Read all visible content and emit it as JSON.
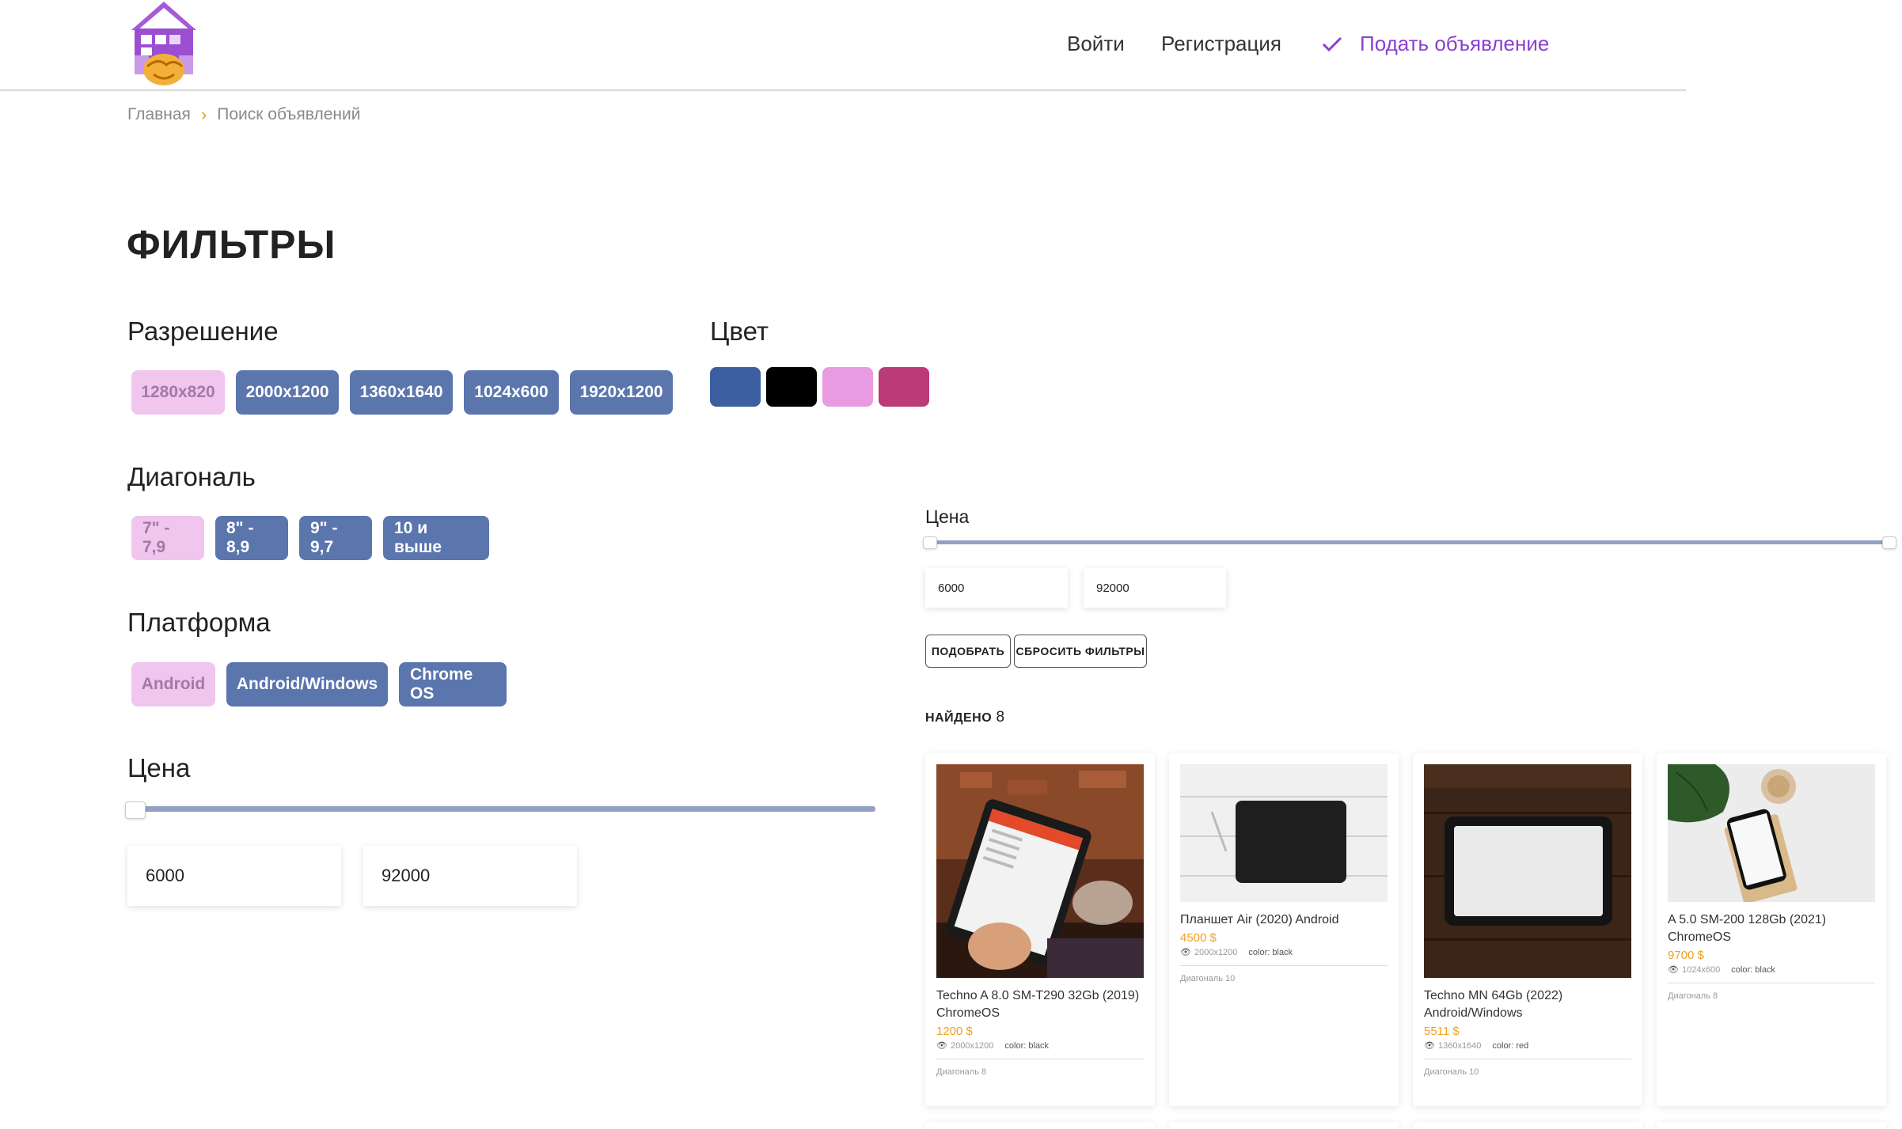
{
  "header": {
    "login": "Войти",
    "register": "Регистрация",
    "post_ad": "Подать объявление"
  },
  "breadcrumb": {
    "home": "Главная",
    "current": "Поиск объявлений"
  },
  "filters": {
    "title": "ФИЛЬТРЫ",
    "resolution": {
      "label": "Разрешение",
      "options": [
        "1280x820",
        "2000x1200",
        "1360x1640",
        "1024x600",
        "1920x1200"
      ],
      "selected": "1280x820"
    },
    "color": {
      "label": "Цвет",
      "swatches": [
        "#3b5fa0",
        "#000000",
        "#e89be0",
        "#bb3a78"
      ]
    },
    "diagonal": {
      "label": "Диагональ",
      "options": [
        "7\" - 7,9",
        "8\" - 8,9",
        "9\" - 9,7",
        "10 и выше"
      ],
      "selected": "7\" - 7,9"
    },
    "platform": {
      "label": "Платформа",
      "options": [
        "Android",
        "Android/Windows",
        "Chrome OS"
      ],
      "selected": "Android"
    },
    "price": {
      "label": "Цена",
      "min": "6000",
      "max": "92000"
    }
  },
  "results_panel": {
    "price_label": "Цена",
    "min": "6000",
    "max": "92000",
    "apply_button": "ПОДОБРАТЬ",
    "reset_button": "СБРОСИТЬ ФИЛЬТРЫ",
    "found_label": "НАЙДЕНО",
    "found_count": "8"
  },
  "products": [
    {
      "title": "Techno A 8.0 SM-T290 32Gb (2019) ChromeOS",
      "price": "1200 $",
      "resolution": "2000x1200",
      "color": "color: black",
      "diagonal": "Диагональ 8"
    },
    {
      "title": "Планшет Air (2020) Android",
      "price": "4500 $",
      "resolution": "2000x1200",
      "color": "color: black",
      "diagonal": "Диагональ 10"
    },
    {
      "title": "Techno MN 64Gb (2022) Android/Windows",
      "price": "5511 $",
      "resolution": "1360x1640",
      "color": "color: red",
      "diagonal": "Диагональ 10"
    },
    {
      "title": "A 5.0 SM-200 128Gb (2021) ChromeOS",
      "price": "9700 $",
      "resolution": "1024x600",
      "color": "color: black",
      "diagonal": "Диагональ 8"
    }
  ],
  "theme": {
    "accent": "#8a3fd1",
    "chip_blue": "#5b75ad",
    "chip_active": "#f0c6ee",
    "price_orange": "#f0a020"
  }
}
